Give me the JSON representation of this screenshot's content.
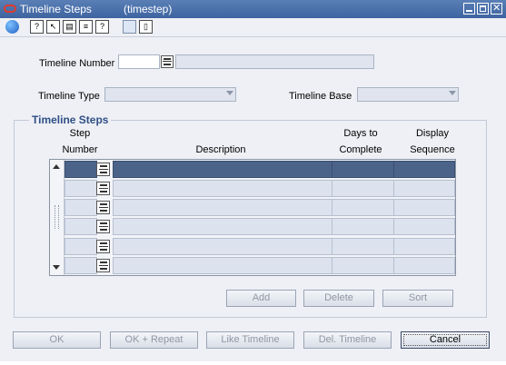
{
  "window": {
    "title": "Timeline Steps",
    "subtitle": "(timestep)"
  },
  "toolbar": {
    "icons": [
      "globe-icon",
      "help-query-icon",
      "cursor-help-icon",
      "save-icon",
      "print-icon",
      "help-icon",
      "blank-icon",
      "new-document-icon"
    ]
  },
  "header": {
    "timeline_number_label": "Timeline Number",
    "timeline_number_value": "",
    "timeline_desc_value": "",
    "timeline_type_label": "Timeline Type",
    "timeline_type_value": "",
    "timeline_base_label": "Timeline Base",
    "timeline_base_value": ""
  },
  "steps": {
    "group_title": "Timeline Steps",
    "columns": {
      "step_number_line1": "Step",
      "step_number_line2": "Number",
      "description": "Description",
      "days_line1": "Days to",
      "days_line2": "Complete",
      "display_line1": "Display",
      "display_line2": "Sequence"
    },
    "rows": [
      {
        "step": "",
        "description": "",
        "days": "",
        "sequence": ""
      },
      {
        "step": "",
        "description": "",
        "days": "",
        "sequence": ""
      },
      {
        "step": "",
        "description": "",
        "days": "",
        "sequence": ""
      },
      {
        "step": "",
        "description": "",
        "days": "",
        "sequence": ""
      },
      {
        "step": "",
        "description": "",
        "days": "",
        "sequence": ""
      },
      {
        "step": "",
        "description": "",
        "days": "",
        "sequence": ""
      }
    ],
    "add_label": "Add",
    "delete_label": "Delete",
    "sort_label": "Sort"
  },
  "footer": {
    "ok_label": "OK",
    "ok_repeat_label": "OK + Repeat",
    "like_timeline_label": "Like Timeline",
    "del_timeline_label": "Del. Timeline",
    "cancel_label": "Cancel"
  },
  "colors": {
    "title_bar": "#3e64a0",
    "selected_row": "#4b6389",
    "group_title": "#2f4f86",
    "background": "#eef0f5"
  }
}
